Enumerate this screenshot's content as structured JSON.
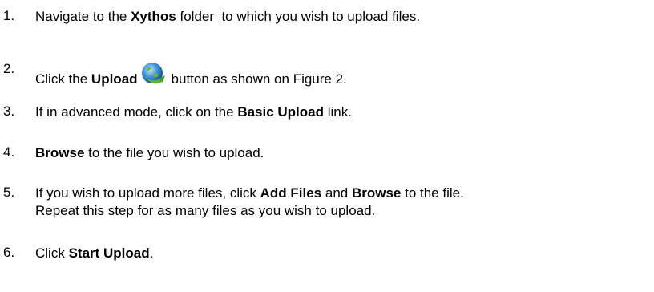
{
  "steps": [
    {
      "num": "1.",
      "parts": [
        "Navigate to the ",
        "Xythos",
        " folder  to which you wish to upload files."
      ]
    },
    {
      "num": "2.",
      "parts": [
        "Click the ",
        "Upload",
        "button as shown on Figure 2."
      ]
    },
    {
      "num": "3.",
      "parts": [
        "If in advanced mode, click on the ",
        "Basic Upload",
        " link."
      ]
    },
    {
      "num": "4.",
      "parts": [
        "Browse",
        " to the file you wish to upload."
      ]
    },
    {
      "num": "5.",
      "parts": [
        "If you wish to upload more files, click ",
        "Add Files",
        " and ",
        "Browse",
        " to the file."
      ],
      "line2": "Repeat this step for as many files as you wish to upload."
    },
    {
      "num": "6.",
      "parts": [
        "Click ",
        "Start Upload",
        "."
      ]
    }
  ],
  "icons": {
    "upload": "upload-globe-icon"
  }
}
